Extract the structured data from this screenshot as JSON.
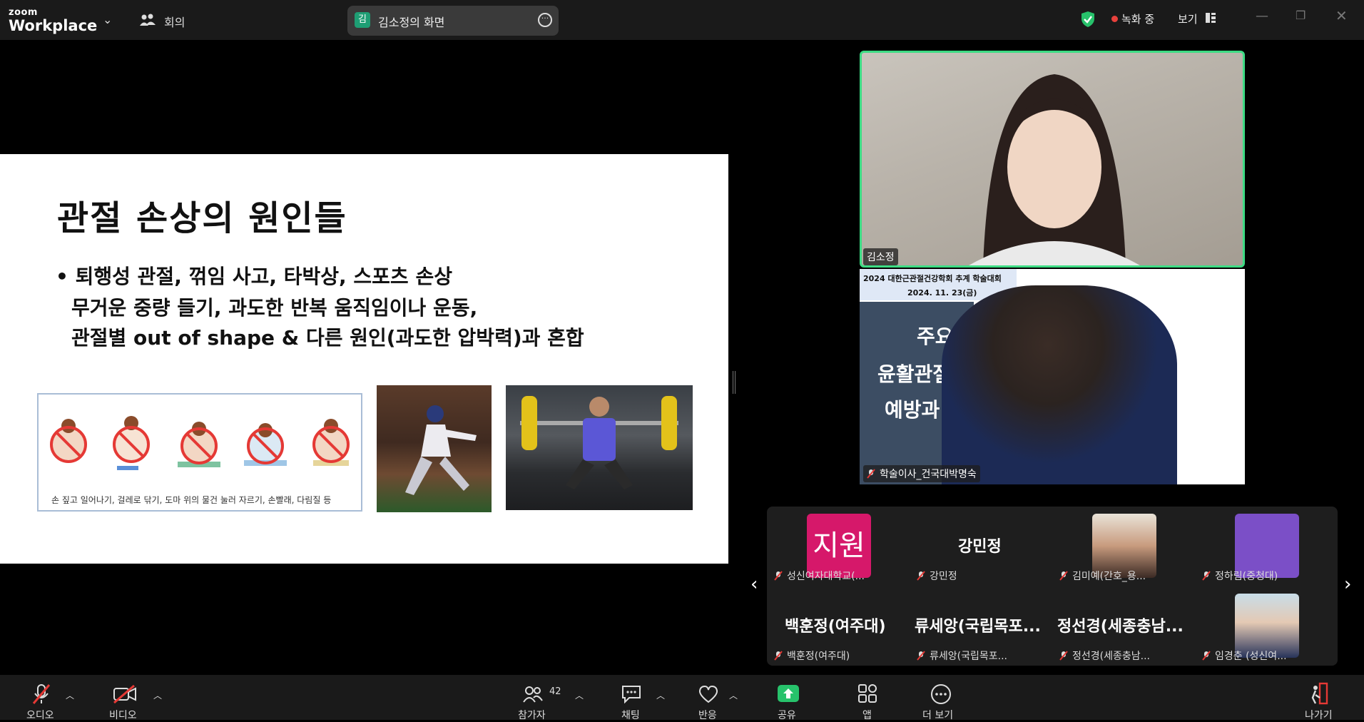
{
  "app": {
    "logo_top": "zoom",
    "logo_main": "Workplace"
  },
  "topbar": {
    "meeting_label": "회의",
    "share_avatar_initial": "김",
    "share_label": "김소정의 화면",
    "recording_label": "녹화 중",
    "view_label": "보기",
    "accent": "#3ddc84",
    "recording_color": "#e8413c"
  },
  "slide": {
    "title": "관절 손상의 원인들",
    "bullet_line1": "• 퇴행성 관절, 꺾임 사고, 타박상, 스포츠 손상",
    "bullet_line2": "무거운 중량 들기, 과도한 반복 움직임이나 운동,",
    "bullet_line3": "관절별 out of shape &  다른 원인(과도한 압박력)과 혼합",
    "illustration_caption": "손 짚고 일어나기, 걸레로 닦기, 도마 위의 물건 눌러 자르기, 손빨래, 다림질 등"
  },
  "videos": {
    "active_speaker_name": "김소정",
    "second_name": "학술이사_건국대박명숙",
    "second_slide_header1": "2024 대한근관절건강학회 추계 학술대회",
    "second_slide_header2": "2024. 11. 23(금)",
    "second_slide_text1": "주요",
    "second_slide_text2": "윤활관절질",
    "second_slide_text3": "예방과"
  },
  "gallery": {
    "tiles": [
      {
        "avatar_text": "지원",
        "name": "성신여자대학교(..."
      },
      {
        "big_name": "강민정",
        "name": "강민정"
      },
      {
        "name": "김미예(간호_용..."
      },
      {
        "name": "정하림(중청대)"
      },
      {
        "big_name": "백훈정(여주대)",
        "name": "백훈정(여주대)"
      },
      {
        "big_name": "류세앙(국립목포...",
        "name": "류세앙(국립목포..."
      },
      {
        "big_name": "정선경(세종충남...",
        "name": "정선경(세종충남..."
      },
      {
        "name": "임경춘 (성신여..."
      }
    ]
  },
  "toolbar": {
    "audio": "오디오",
    "video": "비디오",
    "participants": "참가자",
    "participant_count": "42",
    "chat": "채팅",
    "reactions": "반응",
    "share": "공유",
    "apps": "앱",
    "more": "더 보기",
    "leave": "나가기"
  }
}
